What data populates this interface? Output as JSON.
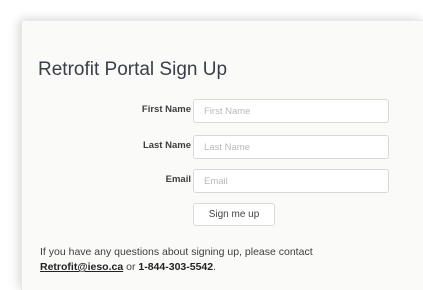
{
  "form": {
    "title": "Retrofit Portal Sign Up",
    "fields": [
      {
        "label": "First Name",
        "placeholder": "First Name",
        "value": ""
      },
      {
        "label": "Last Name",
        "placeholder": "Last Name",
        "value": ""
      },
      {
        "label": "Email",
        "placeholder": "Email",
        "value": ""
      }
    ],
    "submit_label": "Sign me up"
  },
  "contact": {
    "text": "If you have any questions about signing up, please contact",
    "email": "Retrofit@ieso.ca",
    "or": "or",
    "phone": "1-844-303-5542",
    "end": "."
  }
}
